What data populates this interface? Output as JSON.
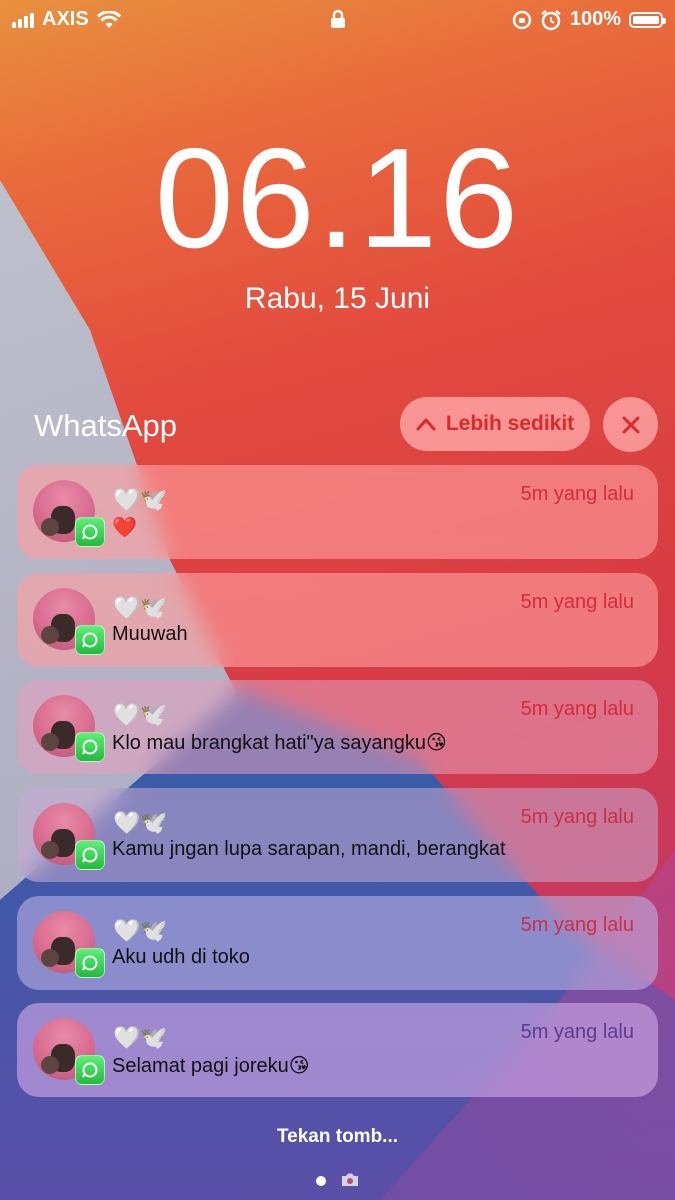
{
  "status_bar": {
    "carrier": "AXIS",
    "battery": "100%"
  },
  "lock_screen": {
    "time": "06.16",
    "date": "Rabu, 15 Juni"
  },
  "group": {
    "app_name": "WhatsApp",
    "show_less_label": "Lebih sedikit"
  },
  "notifications": [
    {
      "sender": "🤍🕊️",
      "time": "5m yang lalu",
      "message": "❤️"
    },
    {
      "sender": "🤍🕊️",
      "time": "5m yang lalu",
      "message": "Muuwah"
    },
    {
      "sender": "🤍🕊️",
      "time": "5m yang lalu",
      "message": "Klo mau brangkat hati\"ya sayangku😘"
    },
    {
      "sender": "🤍🕊️",
      "time": "5m yang lalu",
      "message": "Kamu jngan lupa sarapan, mandi, berangkat"
    },
    {
      "sender": "🤍🕊️",
      "time": "5m yang lalu",
      "message": "Aku udh di toko"
    },
    {
      "sender": "🤍🕊️",
      "time": "5m yang lalu",
      "message": "Selamat pagi joreku😘"
    }
  ],
  "bottom": {
    "hint": "Tekan tomb..."
  },
  "colors": {
    "accent_red": "#d82b2b",
    "whatsapp_green": "#22b93c"
  }
}
